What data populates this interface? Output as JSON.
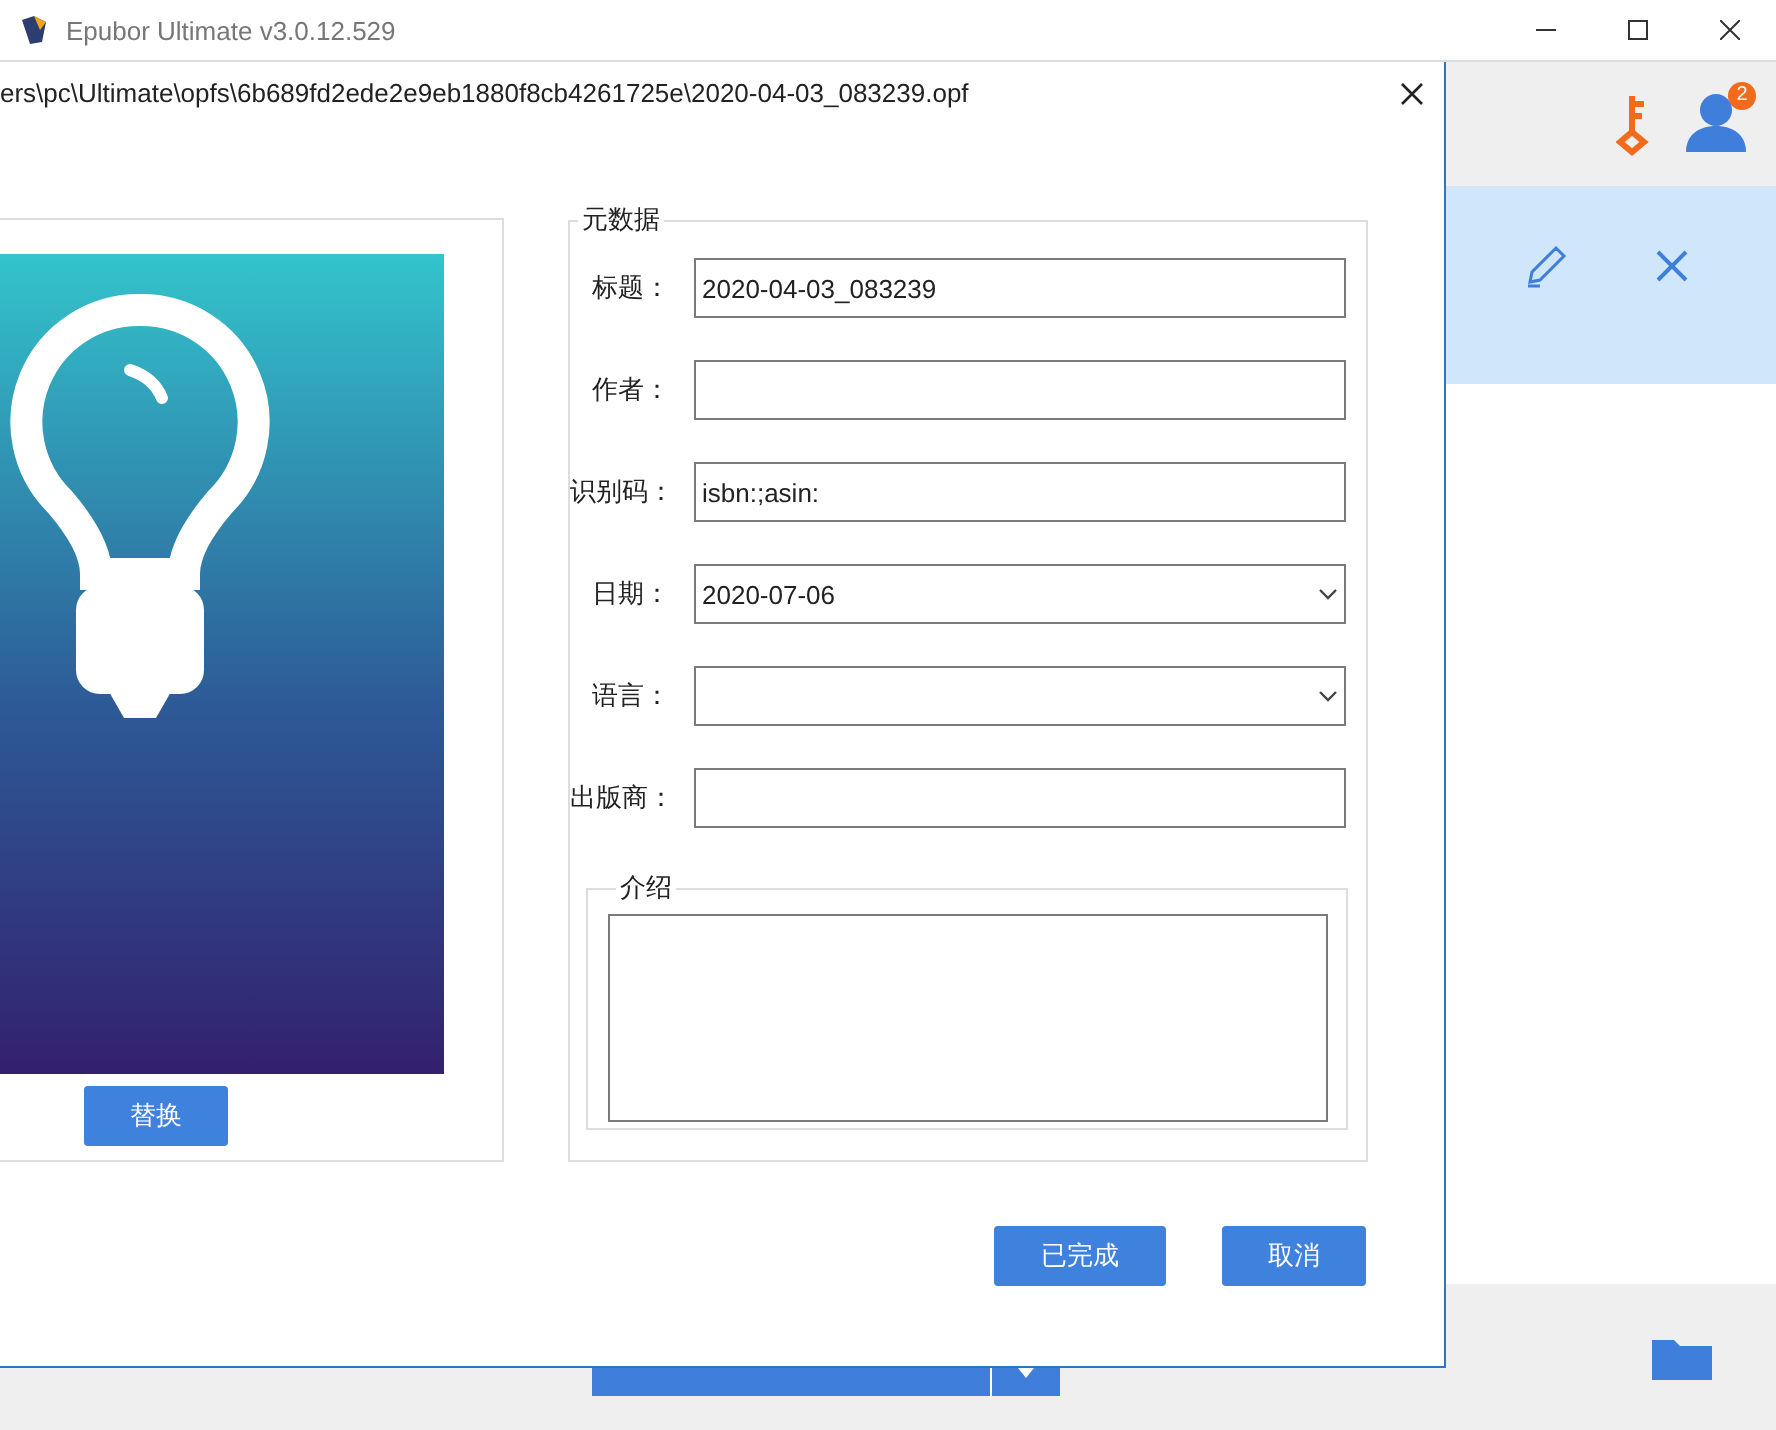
{
  "app": {
    "title": "Epubor Ultimate v3.0.12.529",
    "user_badge": "2"
  },
  "dialog": {
    "path": "ers\\pc\\Ultimate\\opfs\\6b689fd2ede2e9eb1880f8cb4261725e\\2020-04-03_083239.opf",
    "replace_button": "替换",
    "metadata": {
      "legend": "元数据",
      "fields": [
        {
          "label": "标题：",
          "value": "2020-04-03_083239",
          "kind": "text"
        },
        {
          "label": "作者：",
          "kind": "text"
        },
        {
          "label": "识别码：",
          "value": "isbn:;asin:",
          "kind": "text"
        },
        {
          "label": "日期：",
          "value": "2020-07-06",
          "kind": "select"
        },
        {
          "label": "语言：",
          "kind": "select"
        },
        {
          "label": "出版商：",
          "kind": "text"
        }
      ],
      "intro": {
        "legend": "介绍"
      }
    },
    "buttons": [
      "已完成",
      "取消"
    ]
  }
}
